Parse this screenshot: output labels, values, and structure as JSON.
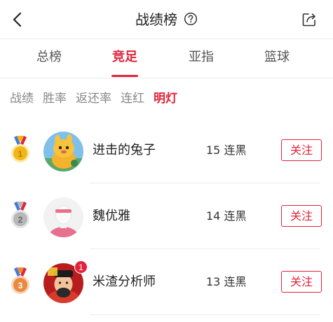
{
  "header": {
    "title": "战绩榜",
    "back_icon": "chevron-left-icon",
    "help_icon": "question-circle-icon",
    "share_icon": "share-icon"
  },
  "main_tabs": [
    {
      "label": "总榜",
      "active": false
    },
    {
      "label": "竞足",
      "active": true
    },
    {
      "label": "亚指",
      "active": false
    },
    {
      "label": "篮球",
      "active": false
    }
  ],
  "sub_tabs": [
    {
      "label": "战绩",
      "active": false
    },
    {
      "label": "胜率",
      "active": false
    },
    {
      "label": "返还率",
      "active": false
    },
    {
      "label": "连红",
      "active": false
    },
    {
      "label": "明灯",
      "active": true
    }
  ],
  "rankings": [
    {
      "rank": "1",
      "name": "进击的兔子",
      "streak": "15 连黑",
      "follow_label": "关注",
      "avatar": "cartoon-character-avatar"
    },
    {
      "rank": "2",
      "name": "魏优雅",
      "streak": "14 连黑",
      "follow_label": "关注",
      "avatar": "default-user-avatar"
    },
    {
      "rank": "3",
      "name": "米渣分析师",
      "streak": "13 连黑",
      "follow_label": "关注",
      "avatar": "fortune-god-avatar",
      "badge": "1"
    }
  ],
  "colors": {
    "accent": "#e2233a",
    "gold": "#f2b619",
    "silver": "#b7b7b7",
    "bronze": "#e98a3f"
  }
}
